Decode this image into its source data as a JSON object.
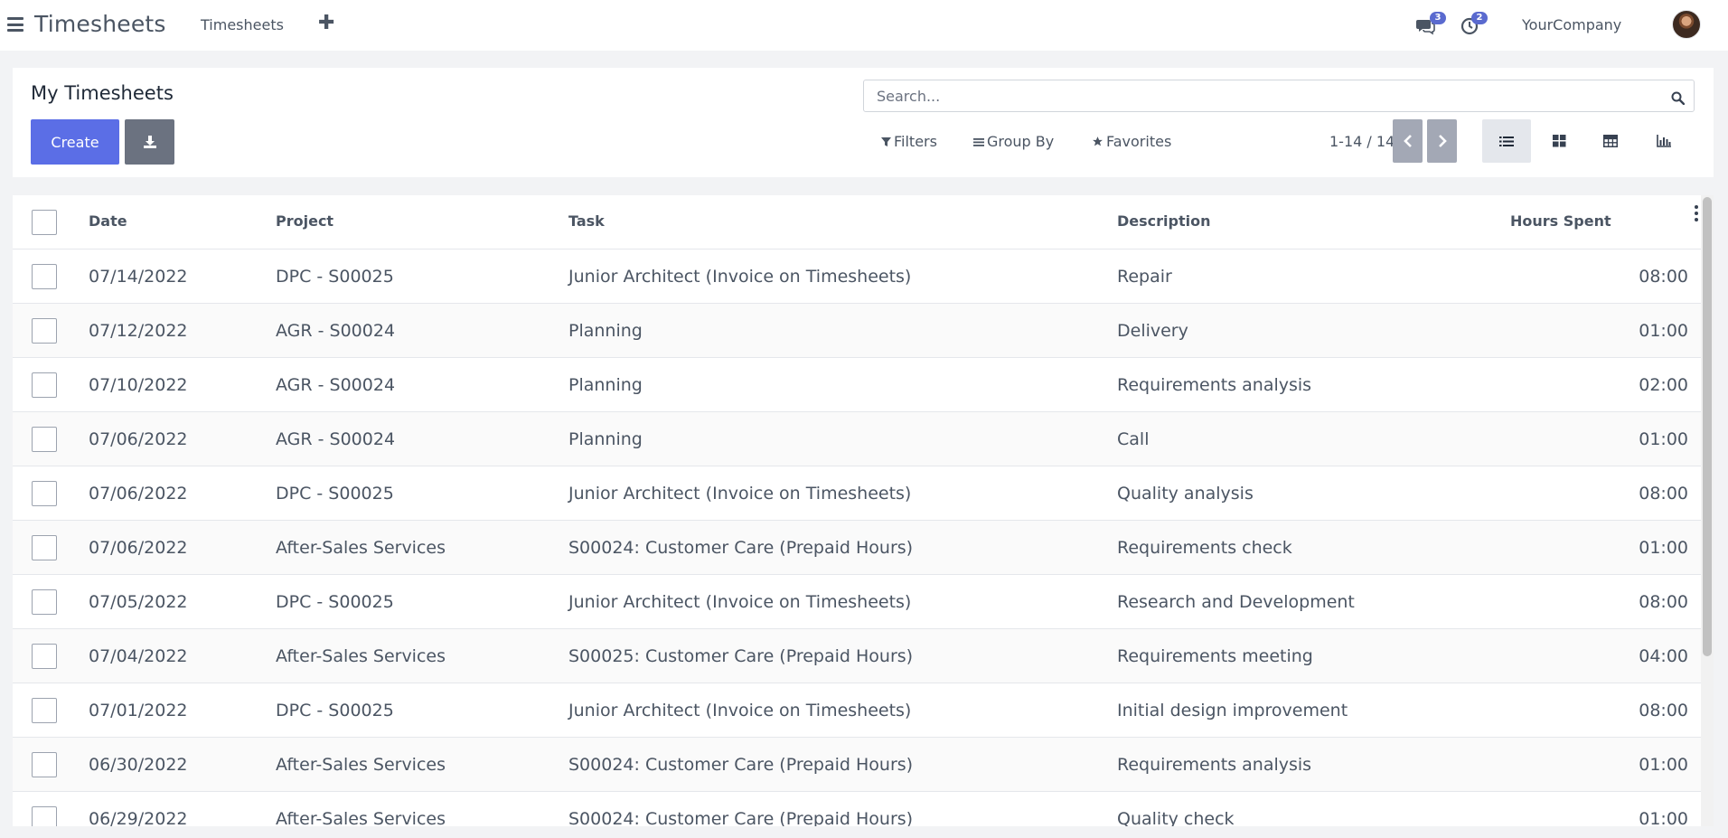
{
  "navbar": {
    "app_title": "Timesheets",
    "menu_link": "Timesheets",
    "new_label": "✚",
    "messages_count": "3",
    "activities_count": "2",
    "company": "YourCompany"
  },
  "control_panel": {
    "title": "My Timesheets",
    "create_label": "Create",
    "search_placeholder": "Search...",
    "filters_label": "Filters",
    "group_by_label": "Group By",
    "favorites_label": "Favorites",
    "pager": "1-14 / 14",
    "views": [
      "list",
      "kanban",
      "grid",
      "graph"
    ],
    "active_view": "list"
  },
  "table": {
    "columns": [
      "Date",
      "Project",
      "Task",
      "Description",
      "Hours Spent"
    ],
    "rows": [
      {
        "date": "07/14/2022",
        "project": "DPC - S00025",
        "task": "Junior Architect (Invoice on Timesheets)",
        "description": "Repair",
        "hours": "08:00"
      },
      {
        "date": "07/12/2022",
        "project": "AGR - S00024",
        "task": "Planning",
        "description": "Delivery",
        "hours": "01:00"
      },
      {
        "date": "07/10/2022",
        "project": "AGR - S00024",
        "task": "Planning",
        "description": "Requirements analysis",
        "hours": "02:00"
      },
      {
        "date": "07/06/2022",
        "project": "AGR - S00024",
        "task": "Planning",
        "description": "Call",
        "hours": "01:00"
      },
      {
        "date": "07/06/2022",
        "project": "DPC - S00025",
        "task": "Junior Architect (Invoice on Timesheets)",
        "description": "Quality analysis",
        "hours": "08:00"
      },
      {
        "date": "07/06/2022",
        "project": "After-Sales Services",
        "task": "S00024: Customer Care (Prepaid Hours)",
        "description": "Requirements check",
        "hours": "01:00"
      },
      {
        "date": "07/05/2022",
        "project": "DPC - S00025",
        "task": "Junior Architect (Invoice on Timesheets)",
        "description": "Research and Development",
        "hours": "08:00"
      },
      {
        "date": "07/04/2022",
        "project": "After-Sales Services",
        "task": "S00025: Customer Care (Prepaid Hours)",
        "description": "Requirements meeting",
        "hours": "04:00"
      },
      {
        "date": "07/01/2022",
        "project": "DPC - S00025",
        "task": "Junior Architect (Invoice on Timesheets)",
        "description": "Initial design improvement",
        "hours": "08:00"
      },
      {
        "date": "06/30/2022",
        "project": "After-Sales Services",
        "task": "S00024: Customer Care (Prepaid Hours)",
        "description": "Requirements analysis",
        "hours": "01:00"
      },
      {
        "date": "06/29/2022",
        "project": "After-Sales Services",
        "task": "S00024: Customer Care (Prepaid Hours)",
        "description": "Quality check",
        "hours": "01:00"
      }
    ]
  },
  "colors": {
    "primary": "#5b6ee6",
    "secondary": "#6b7280",
    "badge": "#5a6acf",
    "text": "#4b5563"
  }
}
